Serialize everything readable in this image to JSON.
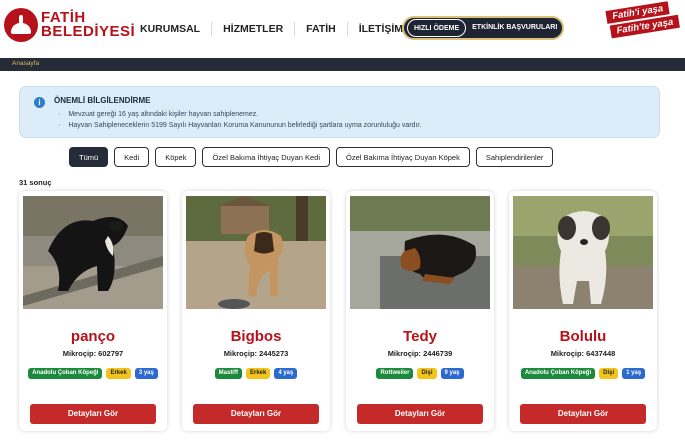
{
  "header": {
    "logo_line1": "FATİH",
    "logo_line2": "BELEDİYESİ",
    "nav": [
      "KURUMSAL",
      "HİZMETLER",
      "FATİH",
      "İLETİŞİM"
    ],
    "quick_pay": "HIZLI ÖDEME",
    "event_apps": "ETKİNLİK BAŞVURULARI",
    "slogan_line1": "Fatih'i yaşa",
    "slogan_line2": "Fatih'te yaşa"
  },
  "breadcrumb": "Anasayfa",
  "info": {
    "title": "ÖNEMLİ BİLGİLENDİRME",
    "items": [
      "Mevzuat gereği 16 yaş altındaki kişiler hayvan sahiplenemez.",
      "Hayvan Sahipleneceklerin 5199 Sayılı Hayvanları Koruma Kanununun belirlediği şartlara uyma zorunluluğu vardır."
    ]
  },
  "filters": [
    "Tümü",
    "Kedi",
    "Köpek",
    "Özel Bakıma İhtiyaç Duyan Kedi",
    "Özel Bakıma İhtiyaç Duyan Köpek",
    "Sahiplendirilenler"
  ],
  "active_filter": "Tümü",
  "result_count": "31 sonuç",
  "cards": [
    {
      "name": "panço",
      "chip": "Mikroçip: 602797",
      "breed": "Anadolu Çoban Köpeği",
      "sex": "Erkek",
      "age": "3 yaş",
      "button": "Detayları Gör"
    },
    {
      "name": "Bigbos",
      "chip": "Mikroçip: 2445273",
      "breed": "Mastiff",
      "sex": "Erkek",
      "age": "4 yaş",
      "button": "Detayları Gör"
    },
    {
      "name": "Tedy",
      "chip": "Mikroçip: 2446739",
      "breed": "Rottweiler",
      "sex": "Dişi",
      "age": "9 yaş",
      "button": "Detayları Gör"
    },
    {
      "name": "Bolulu",
      "chip": "Mikroçip: 6437448",
      "breed": "Anadolu Çoban Köpeği",
      "sex": "Dişi",
      "age": "1 yaş",
      "button": "Detayları Gör"
    }
  ],
  "colors": {
    "brand_red": "#b5121b",
    "dark_navy": "#262b38",
    "info_bg": "#dcecf8",
    "breed_tag": "#1c8a3c",
    "sex_tag": "#f2c41c",
    "age_tag": "#2d6ad0"
  }
}
